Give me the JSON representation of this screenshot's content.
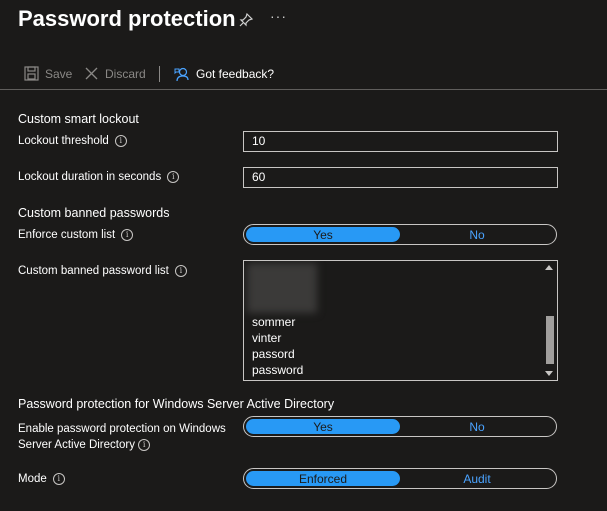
{
  "header": {
    "title": "Password protection",
    "more": "···"
  },
  "toolbar": {
    "save": "Save",
    "discard": "Discard",
    "feedback": "Got feedback?"
  },
  "lockout": {
    "section": "Custom smart lockout",
    "threshold_label": "Lockout threshold",
    "threshold_value": "10",
    "duration_label": "Lockout duration in seconds",
    "duration_value": "60"
  },
  "banned": {
    "section": "Custom banned passwords",
    "enforce_label": "Enforce custom list",
    "enforce_yes": "Yes",
    "enforce_no": "No",
    "list_label": "Custom banned password list",
    "items": [
      "sommer",
      "vinter",
      "passord",
      "password"
    ]
  },
  "windows": {
    "section": "Password protection for Windows Server Active Directory",
    "enable_label": "Enable password protection on Windows Server Active Directory",
    "enable_yes": "Yes",
    "enable_no": "No",
    "mode_label": "Mode",
    "mode_enforced": "Enforced",
    "mode_audit": "Audit"
  },
  "colors": {
    "accent": "#2899f5",
    "link": "#4aa3ff",
    "background": "#1b1a19"
  }
}
